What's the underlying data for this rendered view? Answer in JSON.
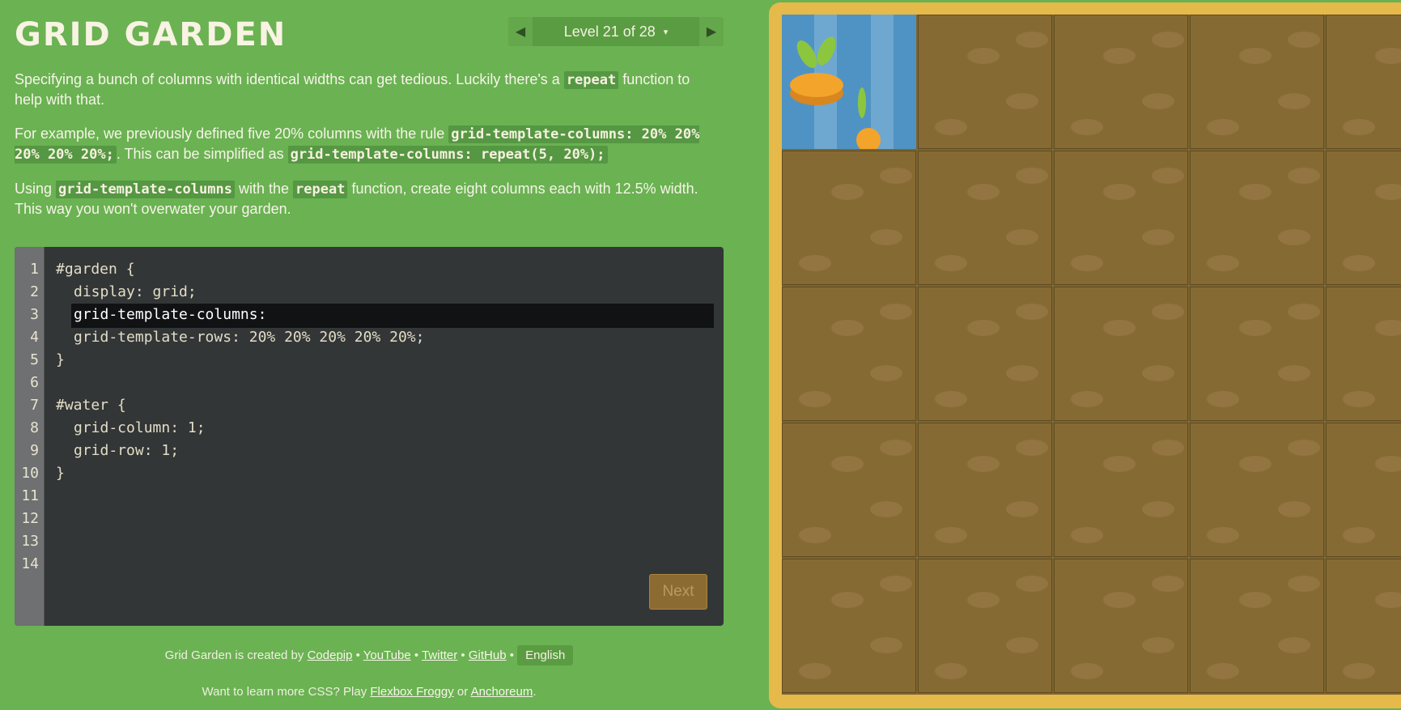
{
  "app": {
    "title": "GRID GARDEN",
    "level_indicator": "Level 21 of 28",
    "caret": "▾",
    "prev_icon": "triangle-left",
    "next_icon": "triangle-right"
  },
  "instructions": {
    "p1_a": "Specifying a bunch of columns with identical widths can get tedious. Luckily there's a ",
    "p1_code": "repeat",
    "p1_b": " function to help with that.",
    "p2_a": "For example, we previously defined five 20% columns with the rule ",
    "p2_code1": "grid-template-columns: 20% 20% 20% 20% 20%;",
    "p2_b": ". This can be simplified as ",
    "p2_code2": "grid-template-columns: repeat(5, 20%);",
    "p3_a": "Using ",
    "p3_code1": "grid-template-columns",
    "p3_b": " with the ",
    "p3_code2": "repeat",
    "p3_c": " function, create eight columns each with 12.5% width. This way you won't overwater your garden."
  },
  "editor": {
    "lines": [
      {
        "num": "1",
        "text": "#garden {"
      },
      {
        "num": "2",
        "text": "display: grid;"
      },
      {
        "num": "3",
        "text": "grid-template-columns:"
      },
      {
        "num": "4",
        "text": "grid-template-rows: 20% 20% 20% 20% 20%;"
      },
      {
        "num": "5",
        "text": "}"
      },
      {
        "num": "6",
        "text": ""
      },
      {
        "num": "7",
        "text": "#water {"
      },
      {
        "num": "8",
        "text": "grid-column: 1;"
      },
      {
        "num": "9",
        "text": "grid-row: 1;"
      },
      {
        "num": "10",
        "text": "}"
      },
      {
        "num": "11",
        "text": ""
      },
      {
        "num": "12",
        "text": ""
      },
      {
        "num": "13",
        "text": ""
      },
      {
        "num": "14",
        "text": ""
      }
    ],
    "next_label": "Next"
  },
  "footer": {
    "created_by": "Grid Garden is created by ",
    "codepip": "Codepip",
    "youtube": "YouTube",
    "twitter": "Twitter",
    "github": "GitHub",
    "sep": " • ",
    "language": "English",
    "learn_more": "Want to learn more CSS? Play ",
    "flexbox": "Flexbox Froggy",
    "or": " or ",
    "anchoreum": "Anchoreum",
    "period": "."
  },
  "colors": {
    "background": "#6ab252",
    "editor_bg": "#333637",
    "garden_frame": "#e5b94a",
    "soil": "#866a33",
    "water": "#4f93c4",
    "carrot": "#f3a42a"
  }
}
